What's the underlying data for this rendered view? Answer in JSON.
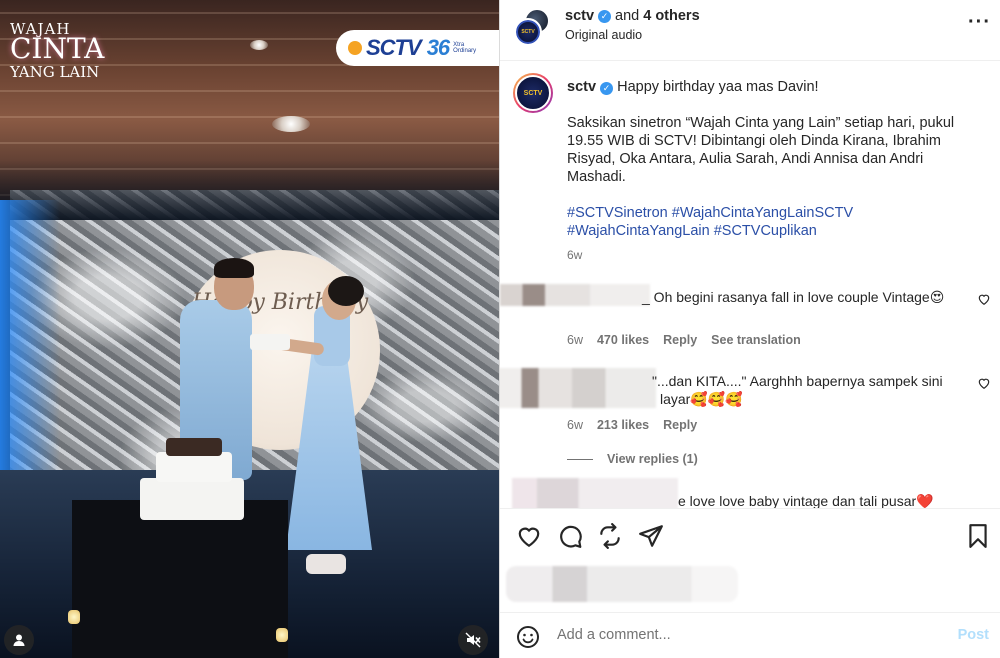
{
  "video": {
    "show_logo": {
      "line1": "WAJAH",
      "line2": "CINTA",
      "line3": "YANG LAIN"
    },
    "channel_badge": {
      "name": "SCTV",
      "number": "36",
      "sub": "Xtra Ordinary"
    },
    "backdrop_text": "Happy Birthday",
    "muted": true
  },
  "post_header": {
    "username": "sctv",
    "and_text": "and",
    "collaborators": "4 others",
    "audio": "Original audio",
    "more_icon": "more-horizontal-icon"
  },
  "caption": {
    "username": "sctv",
    "first_line": "Happy birthday yaa mas Davin!",
    "paragraph": "Saksikan sinetron “Wajah Cinta yang Lain” setiap hari, pukul 19.55 WIB di SCTV! Dibintangi oleh Dinda Kirana, Ibrahim Risyad, Oka Antara, Aulia Sarah, Andi Annisa dan Andri Mashadi.",
    "hashtags": [
      "#SCTVSinetron",
      "#WajahCintaYangLainSCTV",
      "#WajahCintaYangLain",
      "#SCTVCuplikan"
    ],
    "time": "6w"
  },
  "comments": [
    {
      "text": "_ Oh begini rasanya fall in love couple Vintage😍",
      "time": "6w",
      "likes": "470 likes",
      "reply": "Reply",
      "translate": "See translation"
    },
    {
      "text": "\"...dan KITA....\" Aarghhh bapernya sampek sini",
      "text2": "layar🥰🥰🥰",
      "time": "6w",
      "likes": "213 likes",
      "reply": "Reply",
      "view_replies": "View replies (1)"
    },
    {
      "text": "e love love baby vintage dan tali pusar❤️"
    }
  ],
  "actions": {
    "like_icon": "heart-icon",
    "comment_icon": "comment-icon",
    "share_icon": "repost-icon",
    "send_icon": "send-icon",
    "save_icon": "bookmark-icon"
  },
  "composer": {
    "placeholder": "Add a comment...",
    "post_label": "Post",
    "emoji_icon": "emoji-icon"
  },
  "colors": {
    "link_blue": "#2b4fa7",
    "verified": "#3897f0",
    "post_disabled": "#b2dffc",
    "muted_text": "#737373"
  }
}
